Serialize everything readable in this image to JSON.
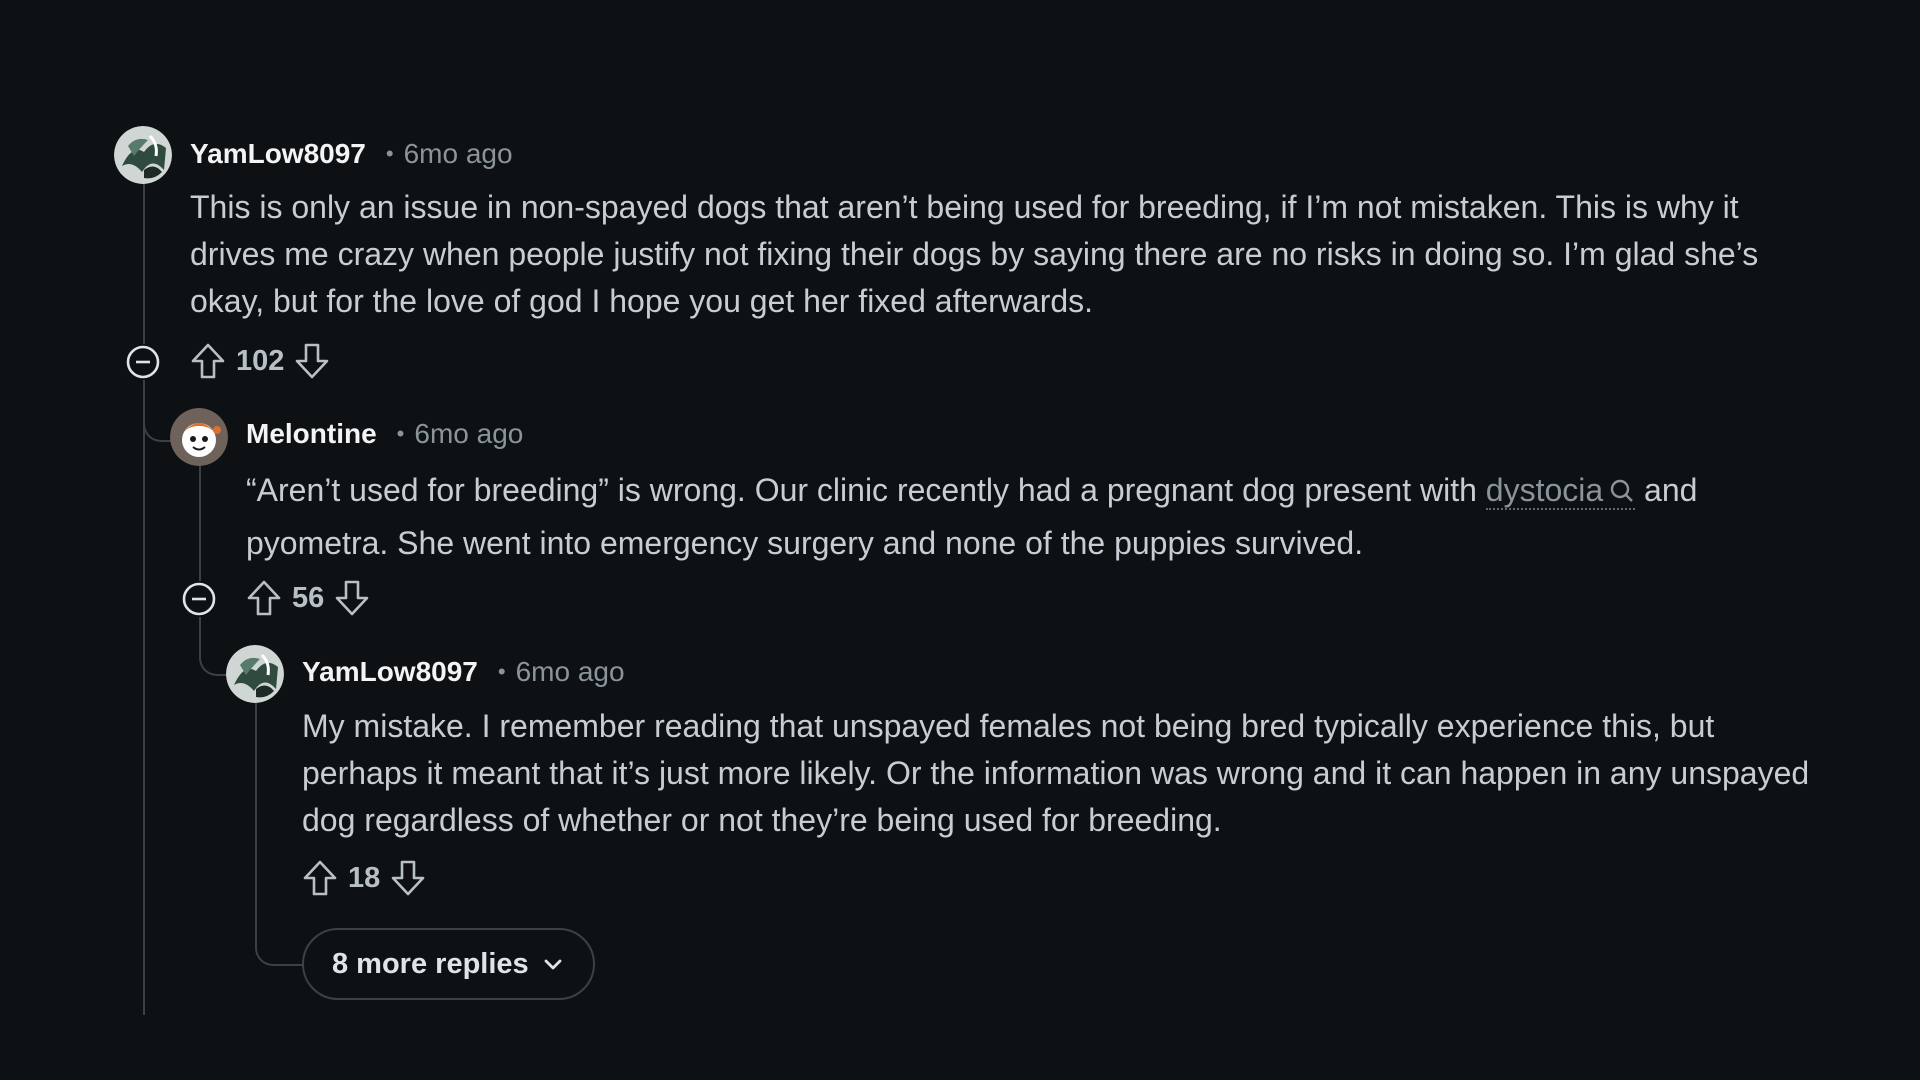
{
  "comments": [
    {
      "author": "YamLow8097",
      "time": "6mo ago",
      "text": "This is only an issue in non-spayed dogs that aren’t being used for breeding, if I’m not mistaken. This is why it drives me crazy when people justify not fixing their dogs by saying there are no risks in doing so. I’m glad she’s okay, but for the love of god I hope you get her fixed afterwards.",
      "votes": "102"
    },
    {
      "author": "Melontine",
      "time": "6mo ago",
      "text_before": "“Aren’t used for breeding” is wrong. Our clinic recently had a pregnant dog present with ",
      "link_text": "dystocia",
      "text_after": " and pyometra. She went into emergency surgery and none of the puppies survived.",
      "votes": "56"
    },
    {
      "author": "YamLow8097",
      "time": "6mo ago",
      "text": "My mistake. I remember reading that unspayed females not being bred typically experience this, but perhaps it meant that it’s just more likely. Or the information was wrong and it can happen in any unspayed dog regardless of whether or not they’re being used for breeding.",
      "votes": "18"
    }
  ],
  "more_replies_label": "8 more replies",
  "separator": "•",
  "icons": {
    "upvote": "arrow-up-outline",
    "downvote": "arrow-down-outline",
    "collapse": "minus-circle",
    "search": "magnifier",
    "chevron": "chevron-down"
  },
  "colors": {
    "background": "#0e1113",
    "thread_line": "#3a4147",
    "author": "#f2f4f5",
    "muted": "#8a949b"
  }
}
